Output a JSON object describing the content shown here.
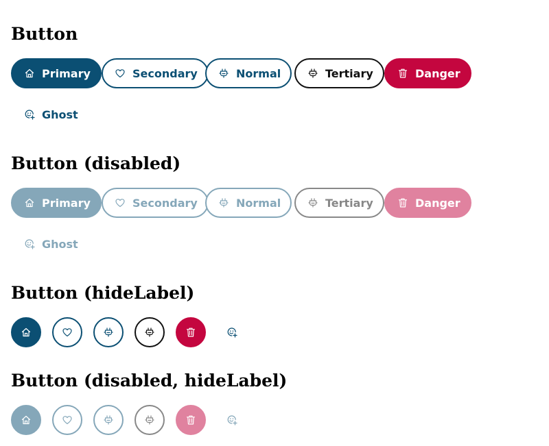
{
  "sections": {
    "normal": {
      "title": "Button"
    },
    "disabled": {
      "title": "Button (disabled)"
    },
    "hide_label": {
      "title": "Button (hideLabel)"
    },
    "disabled_hide_label": {
      "title": "Button (disabled, hideLabel)"
    }
  },
  "buttons": {
    "primary": {
      "label": "Primary",
      "icon": "home-icon"
    },
    "secondary": {
      "label": "Secondary",
      "icon": "heart-icon"
    },
    "normal": {
      "label": "Normal",
      "icon": "plug-icon"
    },
    "tertiary": {
      "label": "Tertiary",
      "icon": "plug-icon"
    },
    "danger": {
      "label": "Danger",
      "icon": "trash-icon"
    },
    "ghost": {
      "label": "Ghost",
      "icon": "add-emoji-icon"
    }
  },
  "colors": {
    "primary": "#0b4f73",
    "primary_disabled": "#85a7b9",
    "danger": "#c4063f",
    "danger_disabled": "#e0829f",
    "tertiary": "#111111",
    "tertiary_disabled": "#888888"
  }
}
